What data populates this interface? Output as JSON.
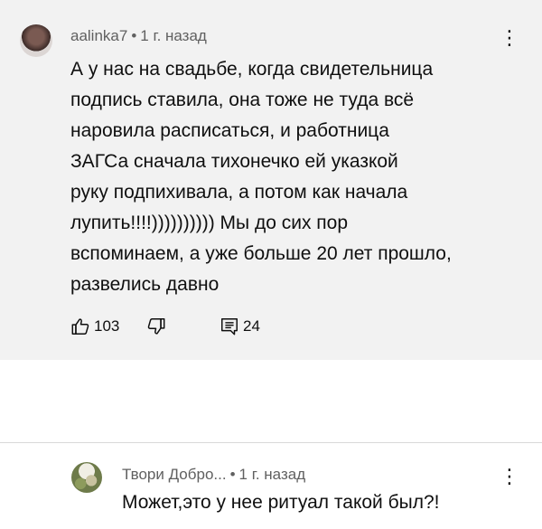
{
  "comment": {
    "author": "aalinka7",
    "separator": "•",
    "time": "1 г. назад",
    "lines": [
      "А у нас на свадьбе, когда свидетельница",
      "подпись ставила, она тоже не туда всё",
      "наровила расписаться, и работница",
      "ЗАГСа сначала тихонечко ей указкой",
      "руку подпихивала, а потом как начала",
      "лупить!!!!)))))))))) Мы до сих пор",
      "вспоминаем, а уже больше 20 лет прошло,",
      "развелись давно"
    ],
    "likes": "103",
    "replies": "24",
    "menu_icon": "⋮"
  },
  "reply": {
    "author": "Твори Добро...",
    "separator": "•",
    "time": "1 г. назад",
    "text": "Может,это у нее ритуал такой был?!",
    "menu_icon": "⋮"
  },
  "colors": {
    "comment_bg": "#f2f2f2",
    "meta_text": "#606060",
    "body_text": "#0f0f0f"
  }
}
